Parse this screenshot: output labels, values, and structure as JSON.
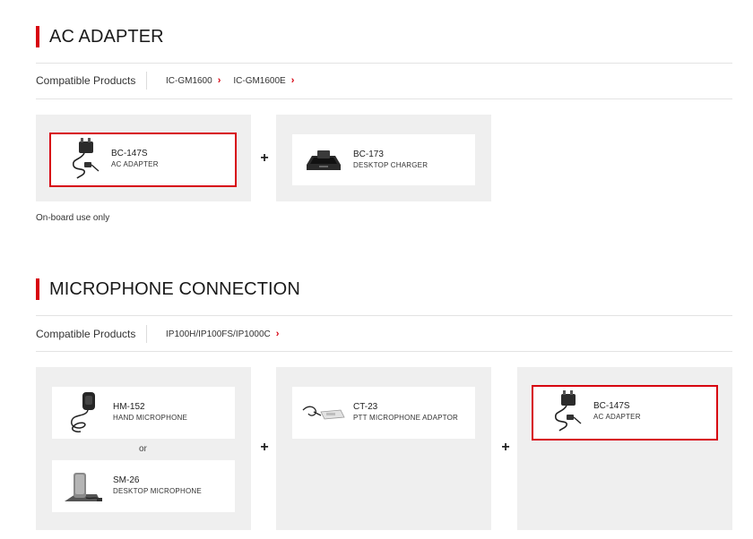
{
  "section1": {
    "title": "AC ADAPTER",
    "compat_label": "Compatible Products",
    "compat_links": [
      "IC-GM1600",
      "IC-GM1600E"
    ],
    "cards": [
      {
        "name": "BC-147S",
        "desc": "AC ADAPTER",
        "icon": "ac-adapter-icon",
        "selected": true
      },
      {
        "name": "BC-173",
        "desc": "DESKTOP CHARGER",
        "icon": "desktop-charger-icon",
        "selected": false
      }
    ],
    "plus": "+",
    "note": "On-board use only"
  },
  "section2": {
    "title": "MICROPHONE CONNECTION",
    "compat_label": "Compatible Products",
    "compat_links": [
      "IP100H/IP100FS/IP1000C"
    ],
    "cards": [
      {
        "name": "HM-152",
        "desc": "HAND MICROPHONE",
        "icon": "hand-microphone-icon",
        "selected": false
      },
      {
        "name": "SM-26",
        "desc": "DESKTOP MICROPHONE",
        "icon": "desktop-microphone-icon",
        "selected": false
      },
      {
        "name": "CT-23",
        "desc": "PTT MICROPHONE ADAPTOR",
        "icon": "ptt-adaptor-icon",
        "selected": false
      },
      {
        "name": "BC-147S",
        "desc": "AC ADAPTER",
        "icon": "ac-adapter-icon",
        "selected": true
      }
    ],
    "or": "or",
    "plus": "+"
  },
  "colors": {
    "accent": "#d7000f",
    "panel_bg": "#efefef",
    "divider": "#e3e3e3"
  }
}
